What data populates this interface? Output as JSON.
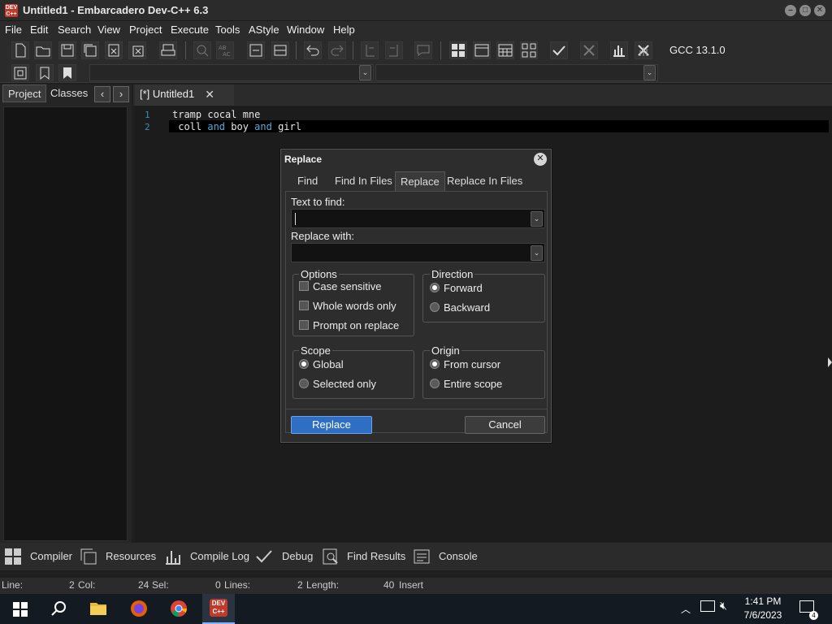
{
  "window": {
    "icon_text": "DEV C++",
    "title": "Untitled1 - Embarcadero Dev-C++ 6.3"
  },
  "menu": [
    "File",
    "Edit",
    "Search",
    "View",
    "Project",
    "Execute",
    "Tools",
    "AStyle",
    "Window",
    "Help"
  ],
  "toolbar": {
    "compiler_label": "GCC 13.1.0"
  },
  "left_panel": {
    "tabs": [
      "Project",
      "Classes"
    ],
    "prev_label": "‹",
    "next_label": "›"
  },
  "editor": {
    "tab_label": "[*] Untitled1",
    "tab_close": "✕",
    "lines": [
      {
        "number": "1",
        "text": "tramp cocal mne"
      },
      {
        "number": "2",
        "parts": [
          " coll ",
          "and",
          " boy ",
          "and",
          " girl"
        ]
      }
    ]
  },
  "dialog": {
    "title": "Replace",
    "close": "✕",
    "tabs": [
      "Find",
      "Find In Files",
      "Replace",
      "Replace In Files"
    ],
    "active_tab": "Replace",
    "find_label": "Text to find:",
    "find_value": "",
    "replace_label": "Replace with:",
    "replace_value": "",
    "options": {
      "title": "Options",
      "items": [
        {
          "label": "Case sensitive",
          "checked": false
        },
        {
          "label": "Whole words only",
          "checked": false
        },
        {
          "label": "Prompt on replace",
          "checked": false
        }
      ]
    },
    "direction": {
      "title": "Direction",
      "items": [
        {
          "label": "Forward",
          "selected": true
        },
        {
          "label": "Backward",
          "selected": false
        }
      ]
    },
    "scope": {
      "title": "Scope",
      "items": [
        {
          "label": "Global",
          "selected": true
        },
        {
          "label": "Selected only",
          "selected": false
        }
      ]
    },
    "origin": {
      "title": "Origin",
      "items": [
        {
          "label": "From cursor",
          "selected": true
        },
        {
          "label": "Entire scope",
          "selected": false
        }
      ]
    },
    "replace_button": "Replace",
    "cancel_button": "Cancel"
  },
  "bottom_tabs": [
    "Compiler",
    "Resources",
    "Compile Log",
    "Debug",
    "Find Results",
    "Console"
  ],
  "status": {
    "line_label": "Line:",
    "line": "2",
    "col_label": "Col:",
    "col": "24",
    "sel_label": "Sel:",
    "sel": "0",
    "lines_label": "Lines:",
    "lines": "2",
    "length_label": "Length:",
    "length": "40",
    "mode": "Insert"
  },
  "taskbar": {
    "time": "1:41 PM",
    "date": "7/6/2023",
    "notification_count": "4"
  },
  "colors": {
    "accent_button": "#2e6fc5",
    "keyword": "#5da9d8",
    "line_number": "#3e8fb0"
  }
}
